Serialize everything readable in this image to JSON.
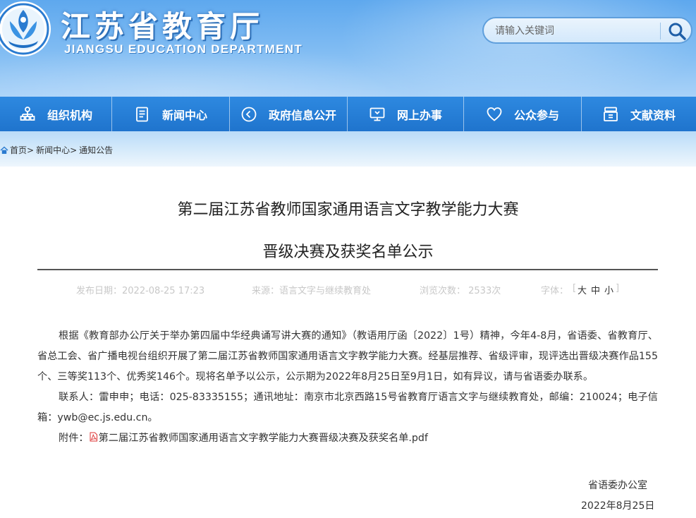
{
  "header": {
    "site_title": "江苏省教育厅",
    "site_subtitle": "JIANGSU EDUCATION DEPARTMENT",
    "search_placeholder": "请输入关键词",
    "colors": {
      "header_top": "#5ea8ee",
      "nav": "#1f74cd"
    }
  },
  "nav": {
    "items": [
      {
        "label": "组织机构",
        "icon": "org-chart-icon"
      },
      {
        "label": "新闻中心",
        "icon": "news-document-icon"
      },
      {
        "label": "政府信息公开",
        "icon": "open-info-icon"
      },
      {
        "label": "网上办事",
        "icon": "monitor-icon"
      },
      {
        "label": "公众参与",
        "icon": "heart-icon"
      },
      {
        "label": "文献资料",
        "icon": "archive-box-icon"
      }
    ]
  },
  "breadcrumb": {
    "items": [
      "首页",
      "新闻中心",
      "通知公告"
    ],
    "separator": ">"
  },
  "article": {
    "title_line1": "第二届江苏省教师国家通用语言文字教学能力大赛",
    "title_line2": "晋级决赛及获奖名单公示",
    "meta": {
      "date": "发布日期：2022-08-25 17:23",
      "source": "来源：语言文字与继续教育处",
      "views": "浏览次数： 2533次",
      "font_label": "字体：",
      "font_large": "大",
      "font_medium": "中",
      "font_small": "小"
    },
    "paragraph1": "根据《教育部办公厅关于举办第四届中华经典诵写讲大赛的通知》（教语用厅函〔2022〕1号）精神，今年4-8月，省语委、省教育厅、省总工会、省广播电视台组织开展了第二届江苏省教师国家通用语言文字教学能力大赛。经基层推荐、省级评审，现评选出晋级决赛作品155个、三等奖113个、优秀奖146个。现将名单予以公示，公示期为2022年8月25日至9月1日，如有异议，请与省语委办联系。",
    "paragraph2": "联系人：雷申申；电话：025-83335155；通讯地址：南京市北京西路15号省教育厅语言文字与继续教育处，邮编：210024；电子信箱：ywb@ec.js.edu.cn。",
    "attachment_label": "附件：",
    "attachment_name": "第二届江苏省教师国家通用语言文字教学能力大赛晋级决赛及获奖名单.pdf",
    "signature_org": "省语委办公室",
    "signature_date": "2022年8月25日"
  }
}
